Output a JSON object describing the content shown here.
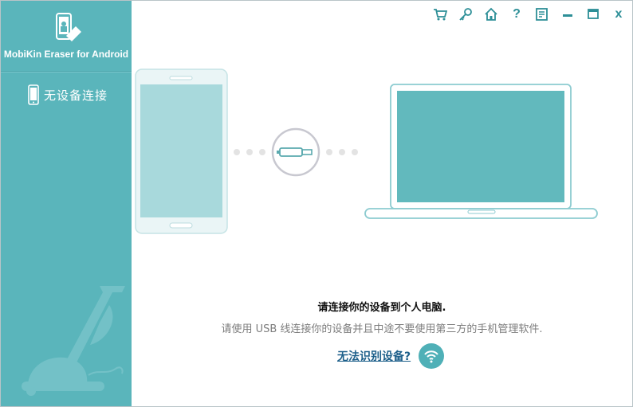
{
  "app": {
    "title": "MobiKin Eraser for Android"
  },
  "sidebar": {
    "device_label": "无设备连接"
  },
  "toolbar": {
    "items": [
      {
        "name": "cart-icon"
      },
      {
        "name": "key-icon"
      },
      {
        "name": "home-icon"
      },
      {
        "name": "help-icon",
        "glyph": "?"
      },
      {
        "name": "feedback-icon"
      },
      {
        "name": "minimize-icon"
      },
      {
        "name": "maximize-icon"
      },
      {
        "name": "close-icon",
        "glyph": "x"
      }
    ]
  },
  "main": {
    "prompt_title": "请连接你的设备到个人电脑.",
    "prompt_desc": "请使用 USB 线连接你的设备并且中途不要使用第三方的手机管理软件.",
    "help_link": "无法识别设备?"
  },
  "colors": {
    "sidebar": "#5ab5bb",
    "accent": "#2d8f97",
    "phone_screen": "#a8d9dc",
    "laptop_screen": "#62b9bd",
    "link": "#1d5f8a"
  }
}
